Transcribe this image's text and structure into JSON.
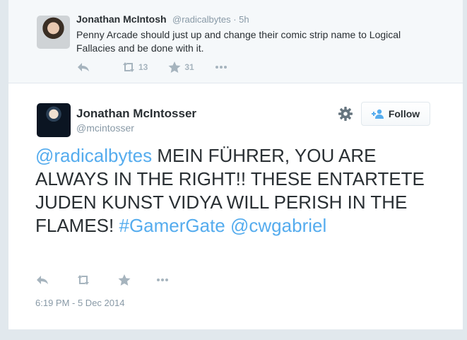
{
  "parent_tweet": {
    "name": "Jonathan McIntosh",
    "handle_time": "@radicalbytes · 5h",
    "text": "Penny Arcade should just up and change their comic strip name to Logical Fallacies and be done with it.",
    "actions": {
      "reply_icon": "reply-icon",
      "retweet_icon": "retweet-icon",
      "retweet_count": "13",
      "favorite_icon": "star-icon",
      "favorite_count": "31",
      "more_icon": "more-dots-icon"
    }
  },
  "main_tweet": {
    "name": "Jonathan McIntosser",
    "handle": "@mcintosser",
    "follow_label": "Follow",
    "text": {
      "mention1": "@radicalbytes",
      "body": " MEIN FÜHRER, YOU ARE ALWAYS IN THE RIGHT!! THESE ENTARTETE JUDEN KUNST VIDYA WILL PERISH IN THE FLAMES! ",
      "hashtag": "#GamerGate",
      "mention2": "@cwgabriel"
    },
    "timestamp": "6:19 PM - 5 Dec 2014"
  },
  "colors": {
    "link": "#55acee",
    "icon_gray": "#a6b4be",
    "secondary_text": "#8899a6",
    "border": "#e1e8ed"
  }
}
